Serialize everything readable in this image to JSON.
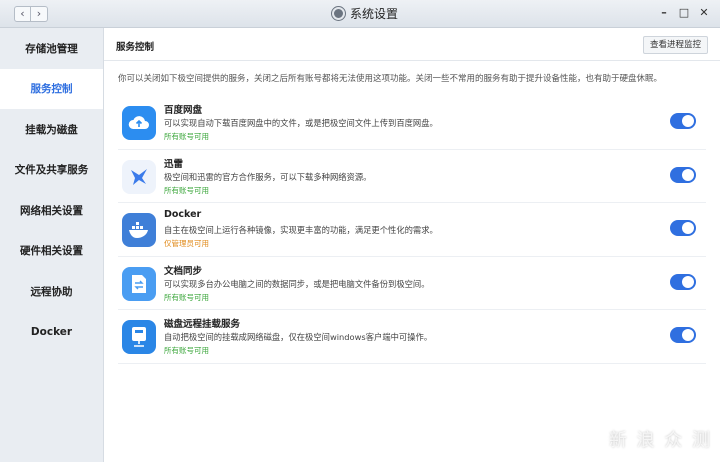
{
  "window": {
    "title": "系统设置",
    "icon": "settings-gear-icon"
  },
  "sidebar": {
    "items": [
      {
        "label": "存储池管理"
      },
      {
        "label": "服务控制"
      },
      {
        "label": "挂载为磁盘"
      },
      {
        "label": "文件及共享服务"
      },
      {
        "label": "网络相关设置"
      },
      {
        "label": "硬件相关设置"
      },
      {
        "label": "远程协助"
      },
      {
        "label": "Docker"
      }
    ]
  },
  "main": {
    "title": "服务控制",
    "log_button": "查看进程监控",
    "description": "你可以关闭如下极空间提供的服务，关闭之后所有账号都将无法使用这项功能。关闭一些不常用的服务有助于提升设备性能，也有助于硬盘休眠。"
  },
  "services": [
    {
      "name": "百度网盘",
      "desc": "可以实现自动下载百度网盘中的文件，或是把极空间文件上传到百度网盘。",
      "tag": "所有账号可用",
      "tag_color": "green",
      "icon": "baidu-cloud-icon",
      "icon_bg": "#2c8df0",
      "enabled": true
    },
    {
      "name": "迅雷",
      "desc": "极空间和迅雷的官方合作服务，可以下载多种网络资源。",
      "tag": "所有账号可用",
      "tag_color": "green",
      "icon": "xunlei-bird-icon",
      "icon_bg": "#eef3fb",
      "enabled": true
    },
    {
      "name": "Docker",
      "desc": "自主在极空间上运行各种镜像，实现更丰富的功能，满足更个性化的需求。",
      "tag": "仅管理员可用",
      "tag_color": "orange",
      "icon": "docker-whale-icon",
      "icon_bg": "#3f7fd8",
      "enabled": true
    },
    {
      "name": "文档同步",
      "desc": "可以实现多台办公电脑之间的数据同步，或是把电脑文件备份到极空间。",
      "tag": "所有账号可用",
      "tag_color": "green",
      "icon": "doc-sync-icon",
      "icon_bg": "#4a9df2",
      "enabled": true
    },
    {
      "name": "磁盘远程挂载服务",
      "desc": "自动把极空间的挂载成网络磁盘，仅在极空间windows客户端中可操作。",
      "tag": "所有账号可用",
      "tag_color": "green",
      "icon": "disk-mount-icon",
      "icon_bg": "#2a86e6",
      "enabled": true
    }
  ],
  "watermark": "新 浪 众 测"
}
